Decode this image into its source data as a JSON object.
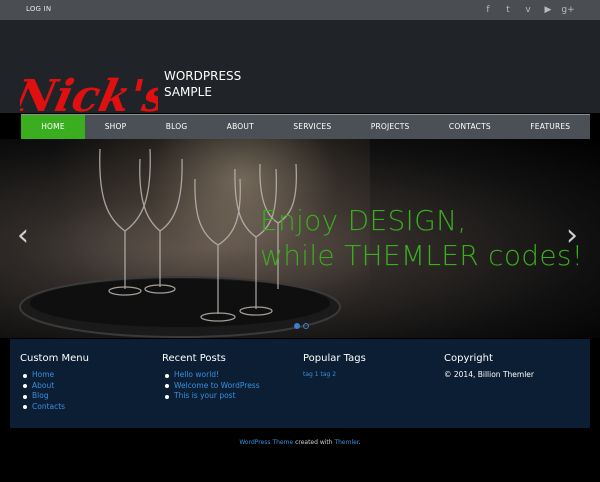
{
  "topbar": {
    "login_label": "LOG IN",
    "social": [
      {
        "name": "facebook-icon",
        "glyph": "f"
      },
      {
        "name": "twitter-icon",
        "glyph": "t"
      },
      {
        "name": "vimeo-icon",
        "glyph": "v"
      },
      {
        "name": "youtube-icon",
        "glyph": "▶"
      },
      {
        "name": "google-plus-icon",
        "glyph": "g+"
      }
    ]
  },
  "header": {
    "logo_text": "Nick's",
    "site_title_line1": "WORDPRESS",
    "site_title_line2": "SAMPLE"
  },
  "nav": {
    "items": [
      "HOME",
      "SHOP",
      "BLOG",
      "ABOUT",
      "SERVICES",
      "PROJECTS",
      "CONTACTS",
      "FEATURES"
    ],
    "active_index": 0
  },
  "slider": {
    "headline_line1": "Enjoy DESIGN,",
    "headline_line2": "while THEMLER codes!",
    "prev_glyph": "‹",
    "next_glyph": "›",
    "slides_count": 2,
    "active_slide": 0
  },
  "widgets": {
    "custom_menu": {
      "title": "Custom Menu",
      "items": [
        "Home",
        "About",
        "Blog",
        "Contacts"
      ]
    },
    "recent_posts": {
      "title": "Recent Posts",
      "items": [
        "Hello world!",
        "Welcome to WordPress",
        "This is your post"
      ]
    },
    "popular_tags": {
      "title": "Popular Tags",
      "tags": "tag 1 tag 2"
    },
    "copyright": {
      "title": "Copyright",
      "text": "© 2014, Billion Themler"
    }
  },
  "credit": {
    "link1": "WordPress Theme",
    "middle": " created with ",
    "link2": "Themler",
    "end": "."
  },
  "colors": {
    "accent_green": "#3aae1f",
    "link_blue": "#3a8fe0",
    "logo_red": "#e01010"
  }
}
